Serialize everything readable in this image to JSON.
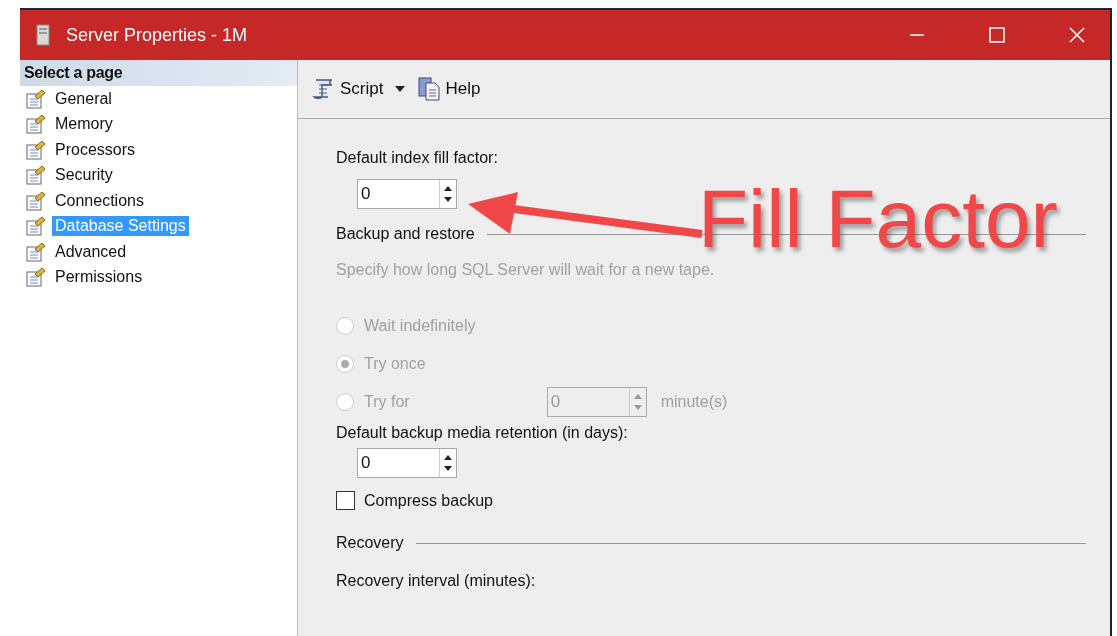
{
  "window": {
    "title": "Server Properties - 1M"
  },
  "sidebar": {
    "heading": "Select a page",
    "items": [
      {
        "label": "General",
        "selected": false
      },
      {
        "label": "Memory",
        "selected": false
      },
      {
        "label": "Processors",
        "selected": false
      },
      {
        "label": "Security",
        "selected": false
      },
      {
        "label": "Connections",
        "selected": false
      },
      {
        "label": "Database Settings",
        "selected": true
      },
      {
        "label": "Advanced",
        "selected": false
      },
      {
        "label": "Permissions",
        "selected": false
      }
    ]
  },
  "toolbar": {
    "script": "Script",
    "help": "Help"
  },
  "fill_factor": {
    "label": "Default index fill factor:",
    "value": "0"
  },
  "backup": {
    "heading": "Backup and restore",
    "hint": "Specify how long SQL Server will wait for a new tape.",
    "disabled": true,
    "options": [
      {
        "kind": "plain",
        "label": "Wait indefinitely",
        "selected": false
      },
      {
        "kind": "plain",
        "label": "Try once",
        "selected": true
      },
      {
        "kind": "timed",
        "label": "Try for",
        "selected": false,
        "value": "0",
        "unit": "minute(s)"
      }
    ],
    "retention_label": "Default backup media retention (in days):",
    "retention_value": "0",
    "compress": {
      "label": "Compress backup",
      "checked": false
    }
  },
  "recovery": {
    "heading": "Recovery",
    "interval_label": "Recovery interval (minutes):"
  },
  "annotation": {
    "text": "Fill Factor"
  }
}
